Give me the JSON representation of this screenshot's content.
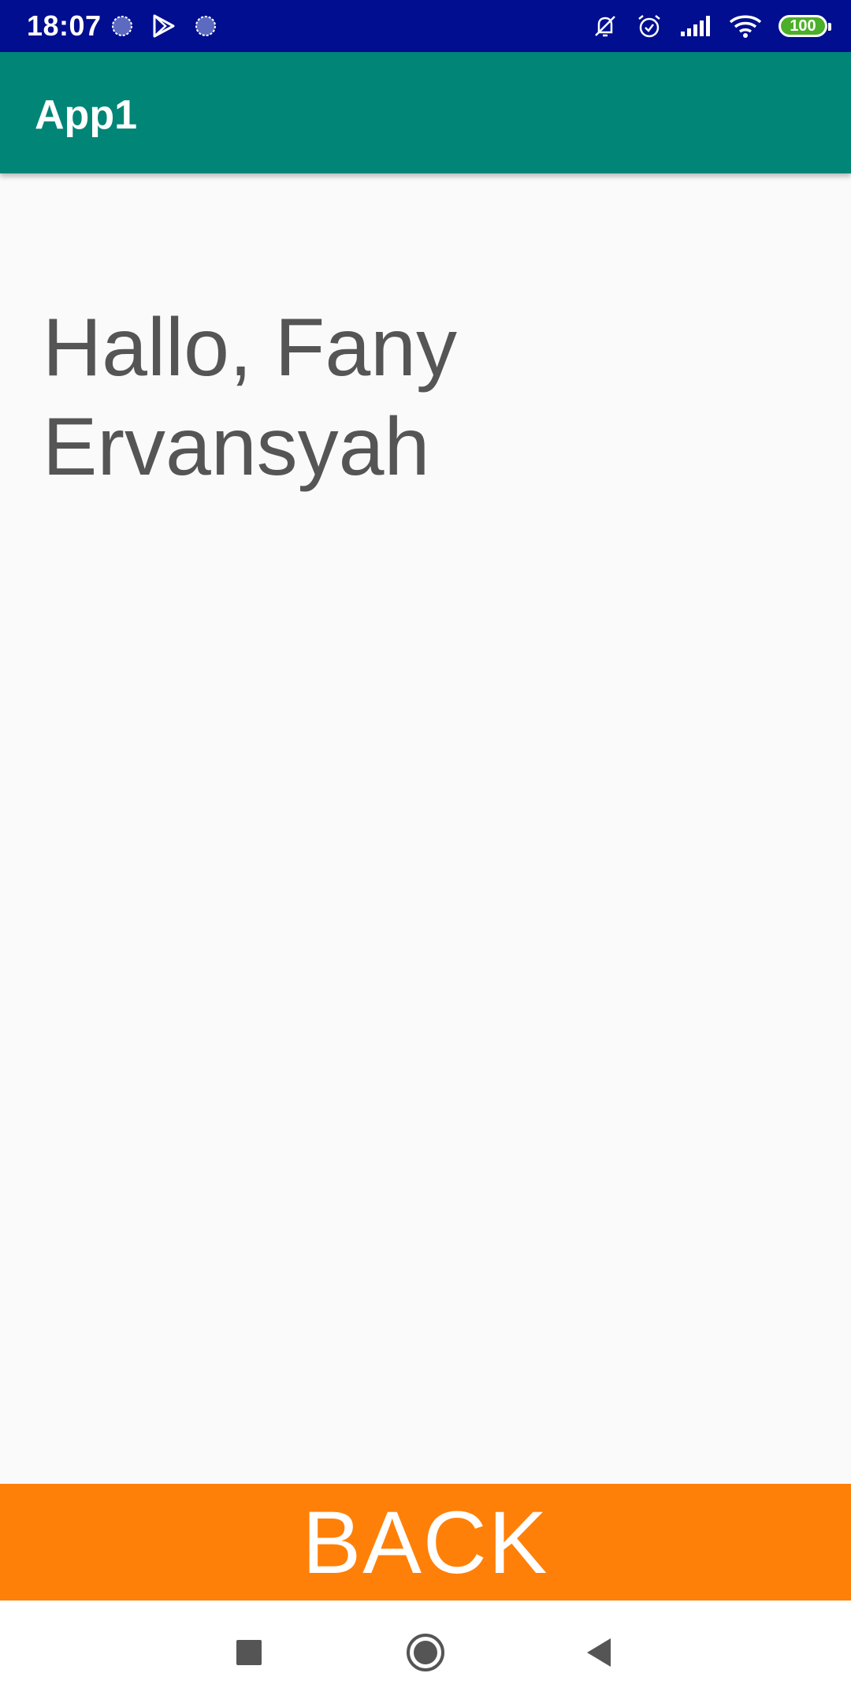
{
  "status_bar": {
    "time": "18:07",
    "battery_level": "100",
    "left_icons": [
      "sync-icon",
      "play-store-icon",
      "sync-icon"
    ],
    "right_icons": [
      "notifications-off-icon",
      "alarm-icon",
      "signal-icon",
      "wifi-icon",
      "battery-icon"
    ],
    "background_color": "#000e8f"
  },
  "app_bar": {
    "title": "App1",
    "background_color": "#008577"
  },
  "content": {
    "greeting_line1": "Hallo, Fany",
    "greeting_line2": "Ervansyah",
    "text_color": "#555555"
  },
  "back_button": {
    "label": "BACK",
    "background_color": "#ff8008"
  },
  "nav_bar": {
    "icons": [
      "recents-icon",
      "home-icon",
      "back-icon"
    ]
  }
}
